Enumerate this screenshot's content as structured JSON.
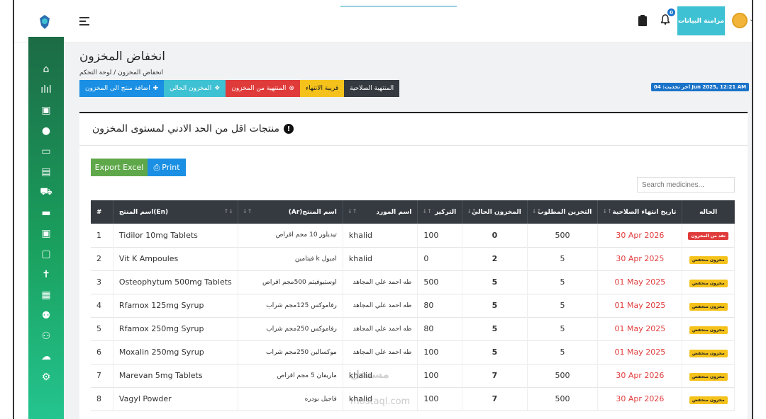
{
  "topbar": {
    "sync_label": "مزامنة البيانات",
    "notification_count": "0"
  },
  "sidebar": {
    "icons": [
      "home-icon",
      "chart-icon",
      "medkit-icon",
      "user-icon",
      "card-icon",
      "document-icon",
      "cart-icon",
      "truck-icon",
      "briefcase-medical-icon",
      "lock-icon",
      "person-icon",
      "building-icon",
      "users-icon",
      "user-plus-icon",
      "cloud-upload-icon",
      "gear-icon"
    ]
  },
  "page": {
    "title": "انخفاض المخزون",
    "breadcrumb": "انخفاض المخزون / لوحة التحكم",
    "last_update": "اخر تحديث: 04 Jun 2025, 12:21 AM"
  },
  "filters": [
    {
      "label": "المنتهية الصلاحية",
      "color": "#343a40",
      "text_color": "#ffffff"
    },
    {
      "label": "قريبة الانتهاء",
      "color": "#f5c21b",
      "text_color": "#222222"
    },
    {
      "label": "المنتهية من المخزون",
      "color": "#e03b3b",
      "text_color": "#ffffff"
    },
    {
      "label": "المخزون الحالي",
      "color": "#3ec1d3",
      "text_color": "#ffffff"
    },
    {
      "label": "اضافة منتج الى المخزون",
      "color": "#1a8fe3",
      "text_color": "#ffffff"
    }
  ],
  "card": {
    "title": "منتجات اقل من الحد الادني لمستوى المخزون",
    "excel_label": "Export Excel",
    "print_label": "Print",
    "search_placeholder": "Search medicines..."
  },
  "table": {
    "columns": [
      "#",
      "اسم المنتج(En)",
      "اسم المنتج(Ar)",
      "اسم المورد",
      "التركيز",
      "المخزون الحالي",
      "التخزين المطلوب",
      "تاريخ انتهاء الصلاحية",
      "الحاله"
    ],
    "rows": [
      {
        "n": "1",
        "en": "Tidilor 10mg Tablets",
        "ar": "تيديلور 10 مجم اقراص",
        "supplier": "khalid",
        "conc": "100",
        "stock": "0",
        "required": "500",
        "expiry": "30 Apr 2026",
        "status": "نفد من المخزون",
        "status_type": "red"
      },
      {
        "n": "2",
        "en": "Vit K Ampoules",
        "ar": "امبول k فيتامين",
        "supplier": "khalid",
        "conc": "0",
        "stock": "2",
        "required": "5",
        "expiry": "30 Apr 2025",
        "status": "مخزون منخفض",
        "status_type": "yellow"
      },
      {
        "n": "3",
        "en": "Osteophytum 500mg Tablets",
        "ar": "اوستيوفيتم 500مجم اقراص",
        "supplier": "طه احمد علي المجاهد",
        "conc": "500",
        "stock": "5",
        "required": "5",
        "expiry": "01 May 2025",
        "status": "مخزون منخفض",
        "status_type": "yellow"
      },
      {
        "n": "4",
        "en": "Rfamox 125mg Syrup",
        "ar": "رفاموكس 125مجم شراب",
        "supplier": "طه احمد علي المجاهد",
        "conc": "80",
        "stock": "5",
        "required": "5",
        "expiry": "01 May 2025",
        "status": "مخزون منخفض",
        "status_type": "yellow"
      },
      {
        "n": "5",
        "en": "Rfamox 250mg Syrup",
        "ar": "رفاموكس 250مجم شراب",
        "supplier": "طه احمد علي المجاهد",
        "conc": "80",
        "stock": "5",
        "required": "5",
        "expiry": "01 May 2025",
        "status": "مخزون منخفض",
        "status_type": "yellow"
      },
      {
        "n": "6",
        "en": "Moxalin 250mg Syrup",
        "ar": "موكسالين 250مجم شراب",
        "supplier": "طه احمد علي المجاهد",
        "conc": "100",
        "stock": "5",
        "required": "5",
        "expiry": "01 May 2025",
        "status": "مخزون منخفض",
        "status_type": "yellow"
      },
      {
        "n": "7",
        "en": "Marevan 5mg Tablets",
        "ar": "ماريفان 5 مجم اقراص",
        "supplier": "khalid",
        "conc": "100",
        "stock": "7",
        "required": "500",
        "expiry": "30 Apr 2026",
        "status": "مخزون منخفض",
        "status_type": "yellow"
      },
      {
        "n": "8",
        "en": "Vagyl Powder",
        "ar": "فاجيل بودره",
        "supplier": "khalid",
        "conc": "100",
        "stock": "7",
        "required": "500",
        "expiry": "30 Apr 2026",
        "status": "مخزون منخفض",
        "status_type": "yellow"
      }
    ]
  },
  "watermark": {
    "ar": "مستقل",
    "en": "mostaql.com"
  }
}
